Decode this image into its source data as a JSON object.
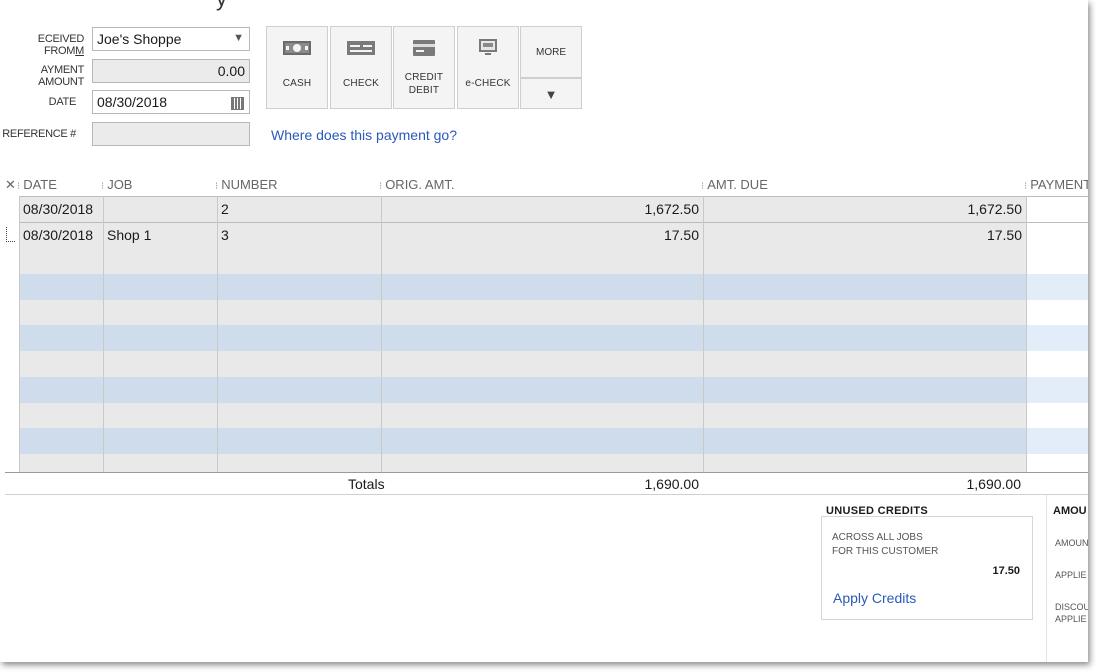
{
  "window": {
    "title_fragment": "y"
  },
  "form": {
    "received_from": {
      "label": "ECEIVED FROM",
      "mnemonic": "M",
      "value": "Joe's Shoppe"
    },
    "payment_amount": {
      "label": "AYMENT AMOUNT",
      "value": "0.00"
    },
    "date": {
      "label": "DATE",
      "value": "08/30/2018"
    },
    "reference": {
      "label": "REFERENCE #",
      "value": ""
    },
    "help_link": "Where does this payment go?"
  },
  "payment_methods": [
    {
      "name": "cash",
      "label": "CASH",
      "icon": "cash-icon"
    },
    {
      "name": "check",
      "label": "CHECK",
      "icon": "check-icon"
    },
    {
      "name": "credit-debit",
      "label_line1": "CREDIT",
      "label_line2": "DEBIT",
      "icon": "credit-card-icon"
    },
    {
      "name": "e-check",
      "label": "e-CHECK",
      "icon": "monitor-icon"
    }
  ],
  "more": {
    "label": "MORE",
    "arrow": "▼"
  },
  "table": {
    "columns": [
      "DATE",
      "JOB",
      "NUMBER",
      "ORIG. AMT.",
      "AMT. DUE",
      "PAYMENT"
    ],
    "rows": [
      {
        "date": "08/30/2018",
        "job": "",
        "number": "2",
        "orig_amt": "1,672.50",
        "amt_due": "1,672.50"
      },
      {
        "date": "08/30/2018",
        "job": "Shop 1",
        "number": "3",
        "orig_amt": "17.50",
        "amt_due": "17.50"
      }
    ],
    "totals_label": "Totals",
    "total_orig_amt": "1,690.00",
    "total_amt_due": "1,690.00"
  },
  "unused_credits": {
    "title": "UNUSED CREDITS",
    "line1": "ACROSS ALL JOBS",
    "line2": "FOR THIS CUSTOMER",
    "amount": "17.50",
    "apply_link": "Apply Credits"
  },
  "amounts_panel": {
    "title": "AMOU",
    "amount_label": "AMOUN",
    "applied_label": "APPLIE",
    "discount_line1": "DISCOU",
    "discount_line2": "APPLIE"
  },
  "colors": {
    "link": "#2a5ab8",
    "row_gray": "#e9e9e9",
    "row_blue": "#cfdcec",
    "payment_blue": "#e3ecf9"
  }
}
